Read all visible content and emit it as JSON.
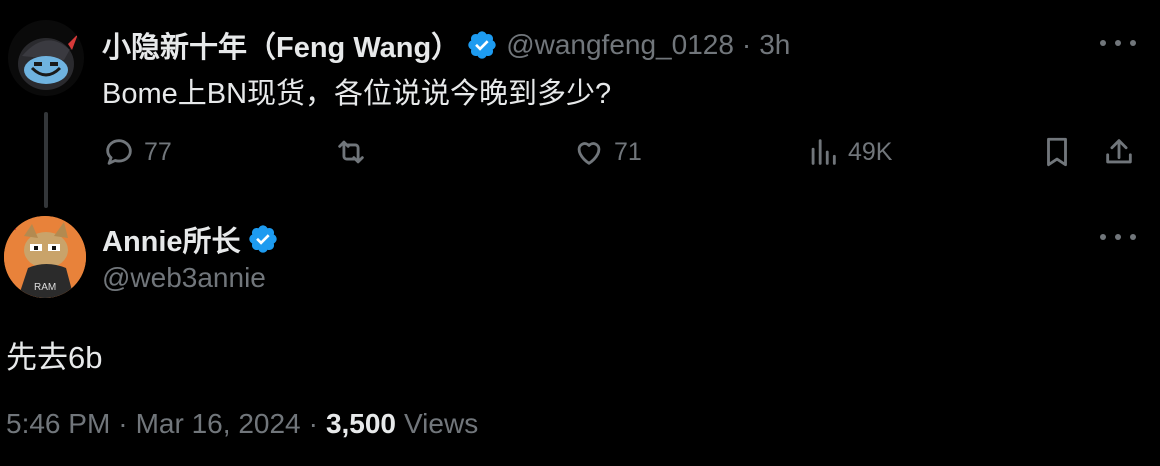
{
  "original_tweet": {
    "display_name": "小隐新十年（Feng Wang）",
    "handle": "@wangfeng_0128",
    "separator": "·",
    "time_ago": "3h",
    "text": "Bome上BN现货，各位说说今晚到多少?",
    "actions": {
      "replies": "77",
      "retweets": "",
      "likes": "71",
      "views": "49K"
    }
  },
  "reply_tweet": {
    "display_name": "Annie所长",
    "handle": "@web3annie",
    "text": "先去6b",
    "time": "5:46 PM",
    "separator": "·",
    "date": "Mar 16, 2024",
    "views_count": "3,500",
    "views_label": "Views"
  },
  "colors": {
    "background": "#000000",
    "primary_text": "#e7e9ea",
    "secondary_text": "#71767b",
    "verified_badge": "#1d9bf0"
  },
  "icons": {
    "verified": "verified-badge-icon",
    "more": "more-dots-icon",
    "reply": "reply-icon",
    "retweet": "retweet-icon",
    "like": "heart-icon",
    "views": "views-chart-icon",
    "bookmark": "bookmark-icon",
    "share": "share-icon"
  }
}
